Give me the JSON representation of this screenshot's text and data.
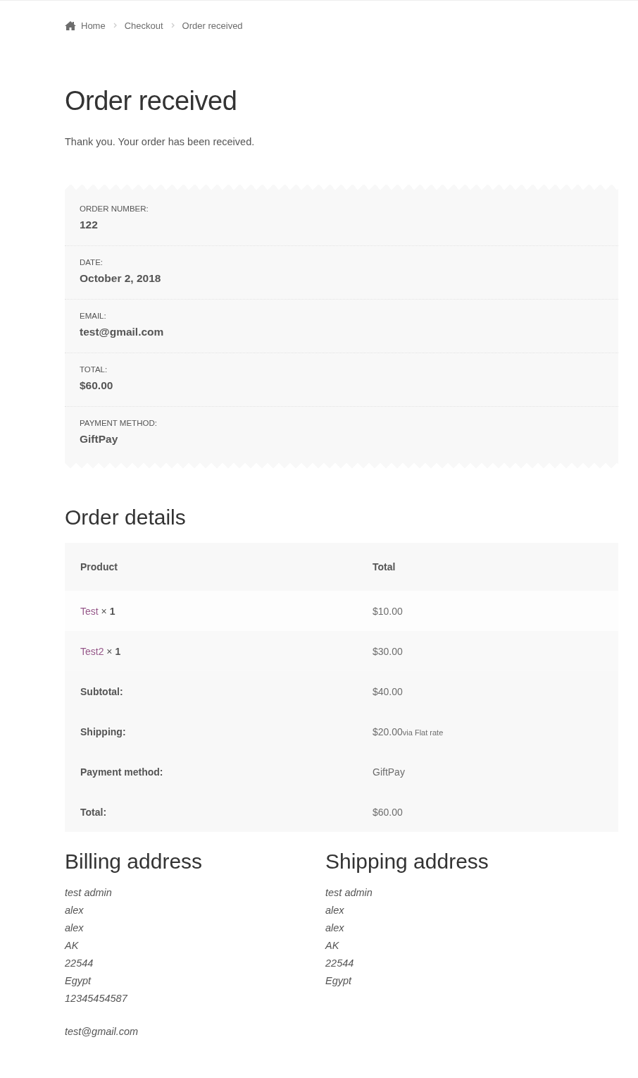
{
  "breadcrumb": [
    {
      "label": "Home",
      "kind": "home"
    },
    {
      "label": "Checkout",
      "kind": "link"
    },
    {
      "label": "Order received",
      "kind": "current"
    }
  ],
  "title": "Order received",
  "notice": "Thank you. Your order has been received.",
  "overview": [
    {
      "label": "ORDER NUMBER:",
      "value": "122"
    },
    {
      "label": "DATE:",
      "value": "October 2, 2018"
    },
    {
      "label": "EMAIL:",
      "value": "test@gmail.com"
    },
    {
      "label": "TOTAL:",
      "value": "$60.00"
    },
    {
      "label": "PAYMENT METHOD:",
      "value": "GiftPay"
    }
  ],
  "order_details": {
    "heading": "Order details",
    "columns": [
      "Product",
      "Total"
    ],
    "items": [
      {
        "product": "Test",
        "quantity": "× **1**",
        "total": "$10.00"
      },
      {
        "product": "Test2",
        "quantity": "× **1**",
        "total": "$30.00"
      }
    ],
    "totals": [
      {
        "label": "Subtotal:",
        "value": "$40.00"
      },
      {
        "label": "Shipping:",
        "value": "$20.00",
        "note": "via Flat rate"
      },
      {
        "label": "Payment method:",
        "value": "GiftPay"
      },
      {
        "label": "Total:",
        "value": "$60.00"
      }
    ]
  },
  "addresses": [
    {
      "heading": "Billing address",
      "lines": [
        "test admin",
        "alex",
        "alex",
        "AK",
        "22544",
        "Egypt",
        "12345454587"
      ],
      "email": "test@gmail.com"
    },
    {
      "heading": "Shipping address",
      "lines": [
        "test admin",
        "alex",
        "alex",
        "AK",
        "22544",
        "Egypt"
      ]
    }
  ]
}
